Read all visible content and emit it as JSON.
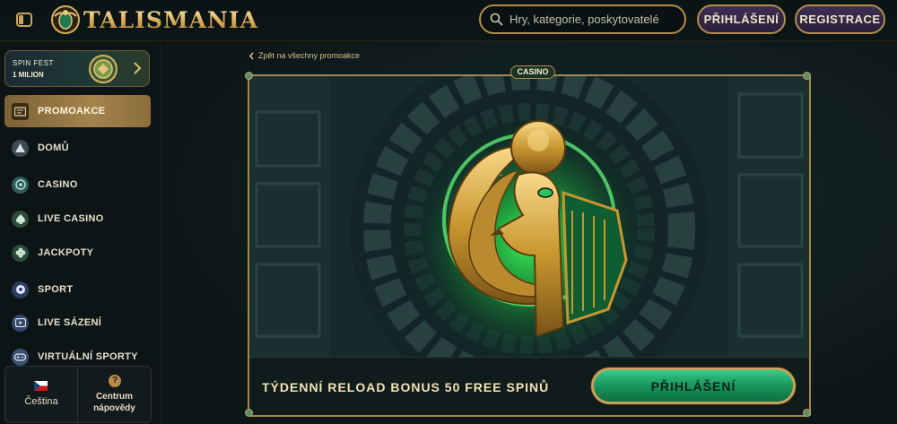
{
  "header": {
    "brand": "TALISMANIA",
    "search_placeholder": "Hry, kategorie, poskytovatelé",
    "login_label": "PŘIHLÁŠENÍ",
    "register_label": "REGISTRACE"
  },
  "sidebar": {
    "promo": {
      "title": "SPIN FEST",
      "subtitle": "1 MILION"
    },
    "items": [
      {
        "label": "PROMOAKCE",
        "icon": "promotions-icon",
        "active": true
      },
      {
        "label": "DOMŮ",
        "icon": "home-icon"
      },
      {
        "label": "CASINO",
        "icon": "casino-icon"
      },
      {
        "label": "LIVE CASINO",
        "icon": "live-casino-icon"
      },
      {
        "label": "JACKPOTY",
        "icon": "jackpot-icon"
      },
      {
        "label": "SPORT",
        "icon": "sport-icon"
      },
      {
        "label": "LIVE SÁZENÍ",
        "icon": "live-betting-icon"
      },
      {
        "label": "VIRTUÁLNÍ SPORTY",
        "icon": "virtual-sports-icon"
      }
    ],
    "language_label": "Čeština",
    "help_label_line1": "Centrum",
    "help_label_line2": "nápovědy"
  },
  "main": {
    "back_link": "Zpět na všechny promoakce",
    "category_tag": "CASINO",
    "offer_title": "TÝDENNÍ RELOAD BONUS 50 FREE SPINŮ",
    "cta_label": "PŘIHLÁŠENÍ"
  },
  "colors": {
    "gold": "#b58d49",
    "active_nav": "#a4844c",
    "cta_green": "#18955d",
    "header_button": "#2a1f3d",
    "background": "#0f1a1c"
  }
}
